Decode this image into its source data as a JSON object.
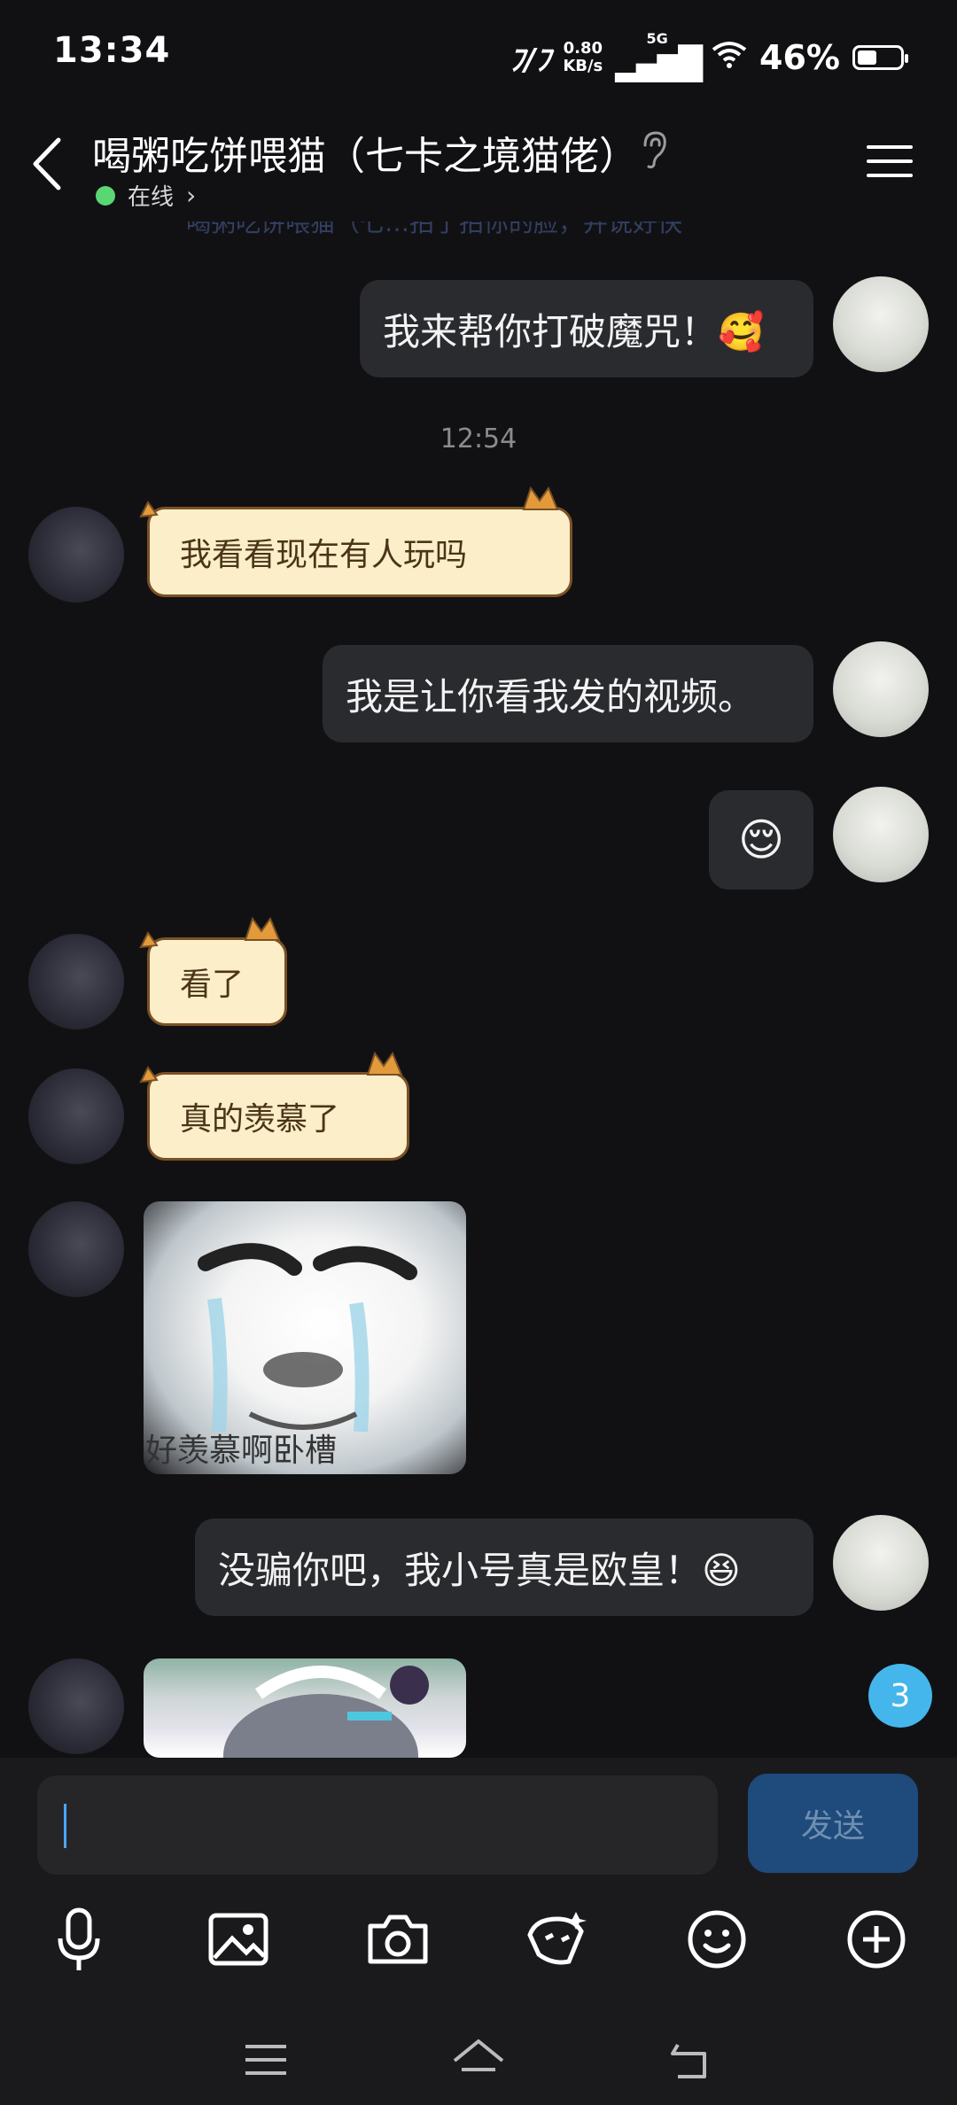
{
  "status_bar": {
    "time": "13:34",
    "network_speed_value": "0.80",
    "network_speed_unit": "KB/s",
    "signal_label": "5G",
    "battery_percent": "46%",
    "battery_level": 0.46
  },
  "header": {
    "title": "喝粥吃饼喂猫（七卡之境猫佬）",
    "status": "在线",
    "status_color": "#5ad673"
  },
  "peek_text": "喝粥吃饼喂猫（七…拍了拍你的脸，并说好快",
  "messages": {
    "m1": {
      "sender": "me",
      "text": "我来帮你打破魔咒！🥰"
    },
    "timestamp": "12:54",
    "m2": {
      "sender": "her",
      "text": "我看看现在有人玩吗"
    },
    "m3": {
      "sender": "me",
      "text": "我是让你看我发的视频。"
    },
    "m4": {
      "sender": "me",
      "text": "😌"
    },
    "m5": {
      "sender": "her",
      "text": "看了"
    },
    "m6": {
      "sender": "her",
      "text": "真的羡慕了"
    },
    "m7": {
      "sender": "her",
      "image": "meme",
      "caption": "好羡慕啊卧槽"
    },
    "m8": {
      "sender": "me",
      "text": "没骗你吧，我小号真是欧皇！😆"
    },
    "m9": {
      "sender": "her",
      "image": "anime-girl"
    }
  },
  "unread_badge": "3",
  "composer": {
    "placeholder": "",
    "send_label": "发送"
  },
  "toolbar_icons": [
    "microphone-icon",
    "image-icon",
    "camera-icon",
    "red-packet-icon",
    "emoji-icon",
    "plus-icon"
  ],
  "nav_icons": [
    "menu-icon",
    "home-icon",
    "back-icon"
  ],
  "colors": {
    "background": "#111114",
    "bubble_me": "#2a2b2f",
    "bubble_cat": "#fbeec8",
    "send_button": "#1f4a7c",
    "badge": "#44b6ec"
  }
}
